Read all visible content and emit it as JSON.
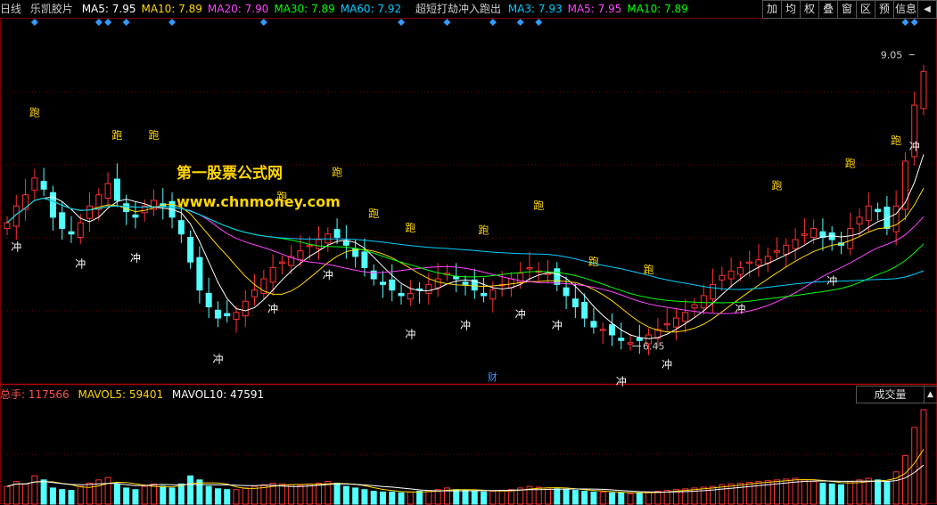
{
  "header": {
    "period": "日线",
    "stock_name": "乐凯胶片",
    "ma_items": [
      {
        "label": "MA5: 7.95",
        "color": "#ffffff"
      },
      {
        "label": "MA10: 7.89",
        "color": "#ffd700"
      },
      {
        "label": "MA20: 7.90",
        "color": "#ff44ff"
      },
      {
        "label": "MA30: 7.89",
        "color": "#00ff00"
      },
      {
        "label": "MA60: 7.92",
        "color": "#00ccff"
      }
    ],
    "indicator_name": "超短打劫冲入跑出",
    "indicator_items": [
      {
        "label": "MA3: 7.93",
        "color": "#00ccff"
      },
      {
        "label": "MA5: 7.95",
        "color": "#ff44ff"
      },
      {
        "label": "MA10: 7.89",
        "color": "#00ff00"
      }
    ]
  },
  "toolbar": {
    "buttons": [
      "加",
      "均",
      "权",
      "叠",
      "窗",
      "区",
      "预",
      "信息"
    ],
    "arrow_icon": "left-triangle-icon"
  },
  "watermark": {
    "title": "第一股票公式网",
    "url": "www.chnmoney.com"
  },
  "volume_header": {
    "total_label": "总手: 117566",
    "mavol5_label": "MAVOL5: 59401",
    "mavol10_label": "MAVOL10: 47591",
    "tab_label": "成交量"
  },
  "annotations": {
    "high_label": "9.05",
    "low_label": "6.45",
    "finance_marker": "财",
    "buy_signal": "冲",
    "sell_signal": "跑"
  },
  "colors": {
    "up": "#ff3232",
    "down": "#54ffff",
    "diamond": "#3399ff",
    "grid": "#7a0000"
  },
  "chart_data": {
    "type": "candlestick",
    "price_range": [
      6.2,
      9.3
    ],
    "close": [
      7.55,
      7.7,
      7.8,
      7.95,
      7.85,
      7.6,
      7.5,
      7.45,
      7.55,
      7.7,
      7.8,
      7.9,
      7.75,
      7.65,
      7.6,
      7.7,
      7.75,
      7.7,
      7.6,
      7.45,
      7.2,
      6.95,
      6.8,
      6.7,
      6.72,
      6.75,
      6.85,
      6.95,
      7.05,
      7.15,
      7.2,
      7.25,
      7.3,
      7.35,
      7.4,
      7.45,
      7.42,
      7.35,
      7.25,
      7.15,
      7.05,
      7.0,
      6.95,
      6.9,
      6.92,
      6.95,
      7.0,
      7.05,
      7.1,
      7.05,
      7.0,
      6.95,
      6.9,
      6.95,
      7.0,
      7.05,
      7.1,
      7.15,
      7.12,
      7.1,
      7.0,
      6.9,
      6.8,
      6.7,
      6.62,
      6.6,
      6.55,
      6.5,
      6.48,
      6.5,
      6.55,
      6.6,
      6.65,
      6.7,
      6.75,
      6.82,
      6.9,
      7.0,
      7.08,
      7.12,
      7.15,
      7.2,
      7.22,
      7.25,
      7.3,
      7.35,
      7.4,
      7.45,
      7.5,
      7.42,
      7.4,
      7.35,
      7.5,
      7.6,
      7.7,
      7.65,
      7.5,
      7.7,
      8.1,
      8.6,
      8.9
    ],
    "high_annotated": 9.05,
    "low_annotated": 6.45,
    "volume": [
      22,
      28,
      25,
      35,
      30,
      20,
      18,
      17,
      22,
      26,
      30,
      33,
      25,
      20,
      18,
      22,
      25,
      22,
      20,
      25,
      35,
      30,
      22,
      19,
      18,
      18,
      20,
      22,
      24,
      26,
      25,
      24,
      23,
      25,
      26,
      28,
      26,
      22,
      20,
      18,
      16,
      15,
      15,
      14,
      15,
      16,
      17,
      18,
      20,
      18,
      17,
      16,
      15,
      16,
      17,
      18,
      20,
      22,
      21,
      20,
      19,
      18,
      17,
      16,
      15,
      15,
      14,
      14,
      13,
      14,
      15,
      16,
      17,
      18,
      19,
      20,
      21,
      22,
      24,
      25,
      26,
      27,
      28,
      29,
      30,
      31,
      32,
      30,
      28,
      26,
      25,
      24,
      28,
      30,
      32,
      30,
      28,
      40,
      60,
      95,
      117
    ]
  }
}
